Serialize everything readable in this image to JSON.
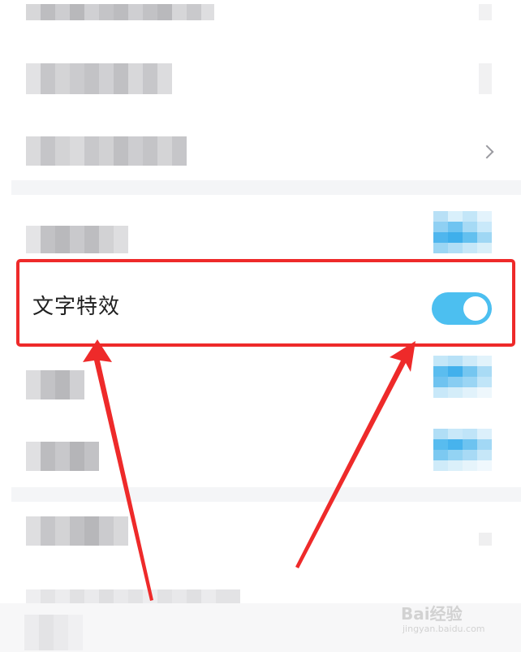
{
  "setting": {
    "label": "文字特效",
    "enabled": true
  },
  "watermark": {
    "logo_text": "Bai经验",
    "url": "jingyan.baidu.com"
  },
  "colors": {
    "highlight": "#ee2a2a",
    "toggle_on": "#4cbff0",
    "arrow": "#ee2a2a"
  },
  "icons": [
    "chevron-right-icon",
    "toggle-switch"
  ]
}
